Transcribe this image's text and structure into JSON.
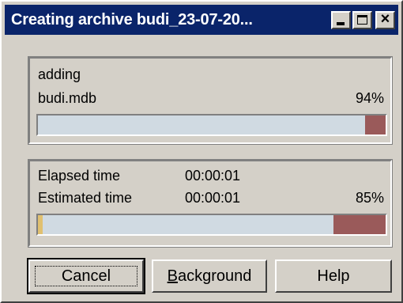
{
  "window": {
    "title": "Creating archive budi_23-07-20..."
  },
  "current_file": {
    "action": "adding",
    "file_name": "budi.mdb",
    "percent_label": "94%",
    "progress": 0.94
  },
  "overall": {
    "elapsed_label": "Elapsed time",
    "elapsed_value": "00:00:01",
    "estimated_label": "Estimated time",
    "estimated_value": "00:00:01",
    "percent_label": "85%",
    "progress": 0.85
  },
  "buttons": {
    "cancel": "Cancel",
    "background": "Background",
    "help": "Help"
  },
  "colors": {
    "titlebar": "#0a246a",
    "progress_done": "#d0dae2",
    "progress_remaining": "#9a5a5a"
  }
}
